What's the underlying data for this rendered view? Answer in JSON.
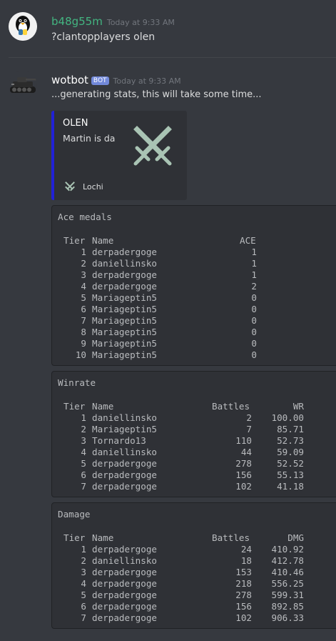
{
  "messages": [
    {
      "author": "b48g55m",
      "author_color": "#43b581",
      "timestamp": "Today at 9:33 AM",
      "text": "?clantopplayers olen",
      "avatar_icon": "penguin-python-icon"
    },
    {
      "author": "wotbot",
      "bot_tag": "BOT",
      "timestamp": "Today at 9:33 AM",
      "text": "...generating stats, this will take some time...",
      "avatar_icon": "tank-icon"
    }
  ],
  "embed": {
    "title": "OLEN",
    "description": "Martin is da",
    "thumbnail_icon": "crossed-swords-icon",
    "footer_icon": "crossed-swords-icon",
    "footer_text": "Lochi",
    "border_color": "#2121d6"
  },
  "tables": {
    "ace": {
      "title": "Ace medals",
      "headers": [
        "Tier",
        "Name",
        "ACE"
      ],
      "rows": [
        [
          "1",
          "derpadergoge",
          "1"
        ],
        [
          "2",
          "daniellinsko",
          "1"
        ],
        [
          "3",
          "derpadergoge",
          "1"
        ],
        [
          "4",
          "derpadergoge",
          "2"
        ],
        [
          "5",
          "Mariageptin5",
          "0"
        ],
        [
          "6",
          "Mariageptin5",
          "0"
        ],
        [
          "7",
          "Mariageptin5",
          "0"
        ],
        [
          "8",
          "Mariageptin5",
          "0"
        ],
        [
          "9",
          "Mariageptin5",
          "0"
        ],
        [
          "10",
          "Mariageptin5",
          "0"
        ]
      ]
    },
    "winrate": {
      "title": "Winrate",
      "headers": [
        "Tier",
        "Name",
        "Battles",
        "WR"
      ],
      "rows": [
        [
          "1",
          "daniellinsko",
          "2",
          "100.00"
        ],
        [
          "2",
          "Mariageptin5",
          "7",
          "85.71"
        ],
        [
          "3",
          "Tornardo13",
          "110",
          "52.73"
        ],
        [
          "4",
          "daniellinsko",
          "44",
          "59.09"
        ],
        [
          "5",
          "derpadergoge",
          "278",
          "52.52"
        ],
        [
          "6",
          "derpadergoge",
          "156",
          "55.13"
        ],
        [
          "7",
          "derpadergoge",
          "102",
          "41.18"
        ]
      ]
    },
    "damage": {
      "title": "Damage",
      "headers": [
        "Tier",
        "Name",
        "Battles",
        "DMG"
      ],
      "rows": [
        [
          "1",
          "derpadergoge",
          "24",
          "410.92"
        ],
        [
          "2",
          "daniellinsko",
          "18",
          "412.78"
        ],
        [
          "3",
          "derpadergoge",
          "153",
          "410.46"
        ],
        [
          "4",
          "derpadergoge",
          "218",
          "556.25"
        ],
        [
          "5",
          "derpadergoge",
          "278",
          "599.31"
        ],
        [
          "6",
          "derpadergoge",
          "156",
          "892.85"
        ],
        [
          "7",
          "derpadergoge",
          "102",
          "906.33"
        ]
      ]
    }
  }
}
